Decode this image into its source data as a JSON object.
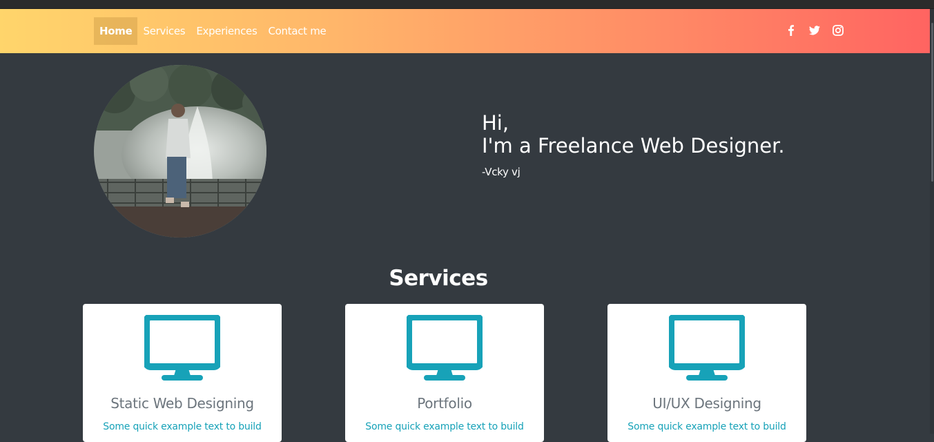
{
  "nav": {
    "links": [
      {
        "label": "Home",
        "active": true
      },
      {
        "label": "Services",
        "active": false
      },
      {
        "label": "Experiences",
        "active": false
      },
      {
        "label": "Contact me",
        "active": false
      }
    ],
    "social": [
      "facebook-icon",
      "twitter-icon",
      "instagram-icon"
    ]
  },
  "hero": {
    "greeting": "Hi,",
    "tagline": "I'm a Freelance Web Designer.",
    "signature": "-Vcky vj"
  },
  "services": {
    "title": "Services",
    "cards": [
      {
        "title": "Static Web Designing",
        "text": "Some quick example text to build",
        "icon": "monitor-icon"
      },
      {
        "title": "Portfolio",
        "text": "Some quick example text to build",
        "icon": "monitor-icon"
      },
      {
        "title": "UI/UX Designing",
        "text": "Some quick example text to build",
        "icon": "monitor-icon"
      }
    ]
  },
  "colors": {
    "nav_gradient_start": "#ffd56b",
    "nav_gradient_end": "#ff6461",
    "page_bg": "#343a40",
    "accent": "#17a2b8",
    "card_title": "#6c757d"
  }
}
